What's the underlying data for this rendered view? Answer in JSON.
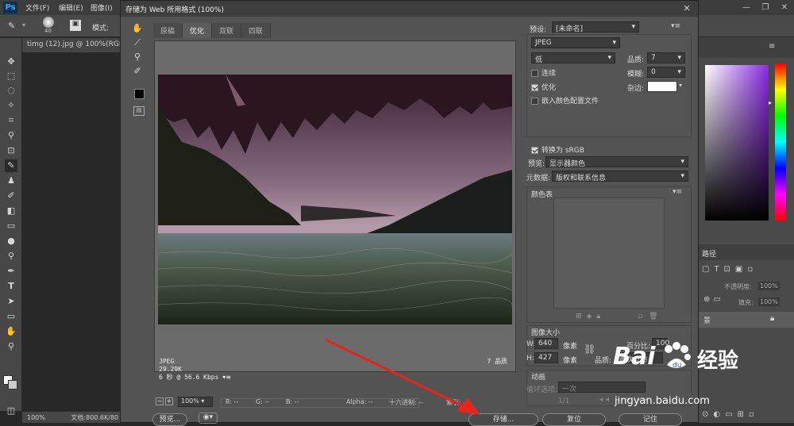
{
  "app": {
    "logo": "Ps",
    "menus": [
      "文件(F)",
      "编辑(E)",
      "图像(I)"
    ],
    "window_controls": [
      "—",
      "❐",
      "✕"
    ],
    "options": {
      "brush_size": "40",
      "mode_label": "模式:"
    },
    "doc_tab": "timg (12).jpg @ 100%(RGB/8",
    "status": {
      "zoom": "100%",
      "doc": "文档:800.6K/80"
    },
    "right_panel": {
      "paths_tab": "路径",
      "opacity_label": "不透明度:",
      "opacity_value": "100%",
      "fill_label": "填充:",
      "fill_value": "100%",
      "layer_label": "景"
    }
  },
  "dialog": {
    "title": "存储为 Web 所用格式 (100%)",
    "close": "✕",
    "tabs": [
      "原稿",
      "优化",
      "双联",
      "四联"
    ],
    "active_tab": 1,
    "image_info": {
      "format": "JPEG",
      "size": "29.29K",
      "time": "6 秒 @ 56.6 Kbps",
      "quality": "7 品质"
    },
    "bottom_bar": {
      "zoom": "100%",
      "r": "R: --",
      "g": "G: --",
      "b": "B: --",
      "alpha": "Alpha: --",
      "hex": "十六进制: --",
      "index": "索引: --"
    },
    "buttons": {
      "preview": "预览...",
      "save": "存储...",
      "reset": "复位",
      "remember": "记住"
    },
    "settings": {
      "preset_label": "预设:",
      "preset_value": "[未命名]",
      "format": "JPEG",
      "quality_level": "低",
      "quality_label": "品质:",
      "quality_value": "7",
      "progressive": "连续",
      "blur_label": "模糊:",
      "blur_value": "0",
      "optimized": "优化",
      "matte_label": "杂边:",
      "embed_profile": "嵌入颜色配置文件",
      "convert_srgb": "转换为 sRGB",
      "preview_label": "预览:",
      "preview_value": "显示器颜色",
      "metadata_label": "元数据:",
      "metadata_value": "版权和联系信息",
      "color_table": "颜色表",
      "image_size": "图像大小",
      "width_label": "W:",
      "width_value": "640",
      "height_label": "H:",
      "height_value": "427",
      "unit": "像素",
      "percent_label": "百分比:",
      "percent_value": "100",
      "quality2_label": "品质:",
      "quality2_value": "两次立方",
      "animation": "动画",
      "loop_label": "循环选项:",
      "loop_value": "一次",
      "frame": "1/1"
    }
  },
  "watermark": {
    "brand": "Bai",
    "brand2": "经验",
    "url": "jingyan.baidu.com"
  }
}
